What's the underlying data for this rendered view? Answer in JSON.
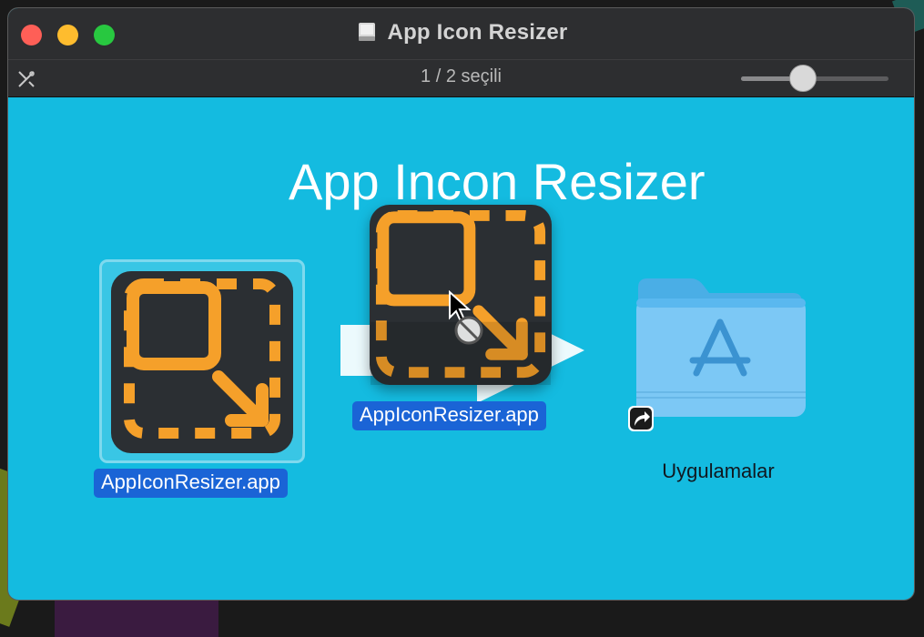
{
  "window": {
    "title": "App Icon Resizer",
    "status": "1 / 2 seçili",
    "icon_size_slider": {
      "fraction": 0.4
    }
  },
  "background": {
    "heading": "App Incon Resizer",
    "color": "#14bbe0"
  },
  "items": {
    "app": {
      "label": "AppIconResizer.app",
      "icon": "resize-app-icon",
      "selected": true
    },
    "dragging": {
      "label": "AppIconResizer.app",
      "icon": "resize-app-icon",
      "cursor": "not-allowed-cursor"
    },
    "folder": {
      "label": "Uygulamalar",
      "icon": "applications-folder-icon",
      "alias": "alias-arrow-icon"
    }
  },
  "colors": {
    "accent_orange": "#f5a02a",
    "selection_blue": "#1a64d6",
    "titlebar": "#2d2e30"
  }
}
